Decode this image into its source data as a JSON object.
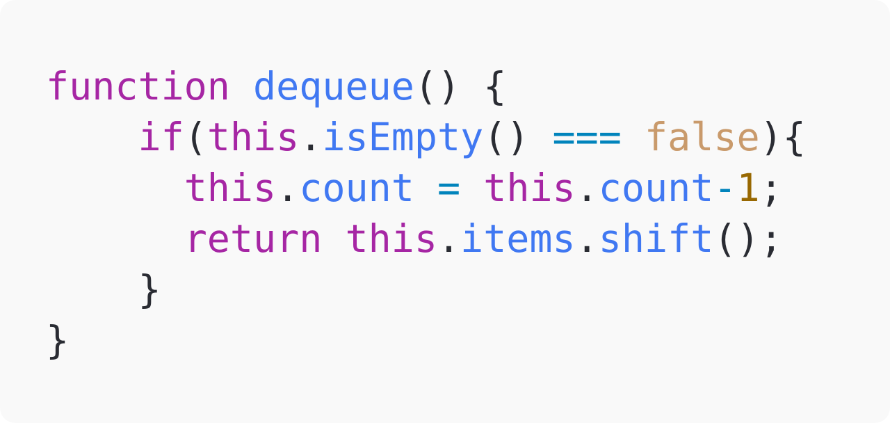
{
  "code": {
    "line1": {
      "indent": "",
      "kw_function": "function",
      "sp1": " ",
      "fn_name": "dequeue",
      "parens": "()",
      "sp2": " ",
      "brace_open": "{"
    },
    "line2": {
      "indent": "    ",
      "kw_if": "if",
      "paren_open": "(",
      "this": "this",
      "dot": ".",
      "method": "isEmpty",
      "call": "()",
      "sp1": " ",
      "op": "===",
      "sp2": " ",
      "bool": "false",
      "paren_close": ")",
      "brace_open": "{"
    },
    "line3": {
      "indent": "      ",
      "this1": "this",
      "dot1": ".",
      "prop1": "count",
      "sp1": " ",
      "assign": "=",
      "sp2": " ",
      "this2": "this",
      "dot2": ".",
      "prop2": "count",
      "minus": "-",
      "number": "1",
      "semi": ";"
    },
    "line4": {
      "indent": "      ",
      "kw_return": "return",
      "sp1": " ",
      "this": "this",
      "dot1": ".",
      "prop": "items",
      "dot2": ".",
      "method": "shift",
      "call": "()",
      "semi": ";"
    },
    "line5": {
      "indent": "    ",
      "brace_close": "}"
    },
    "line6": {
      "indent": "",
      "brace_close": "}"
    }
  },
  "colors": {
    "background": "#f9f9f9",
    "keyword": "#a626a4",
    "function": "#4078f2",
    "operator": "#0184bc",
    "boolean": "#c99a6b",
    "number": "#986801",
    "punctuation": "#2a2c33"
  }
}
